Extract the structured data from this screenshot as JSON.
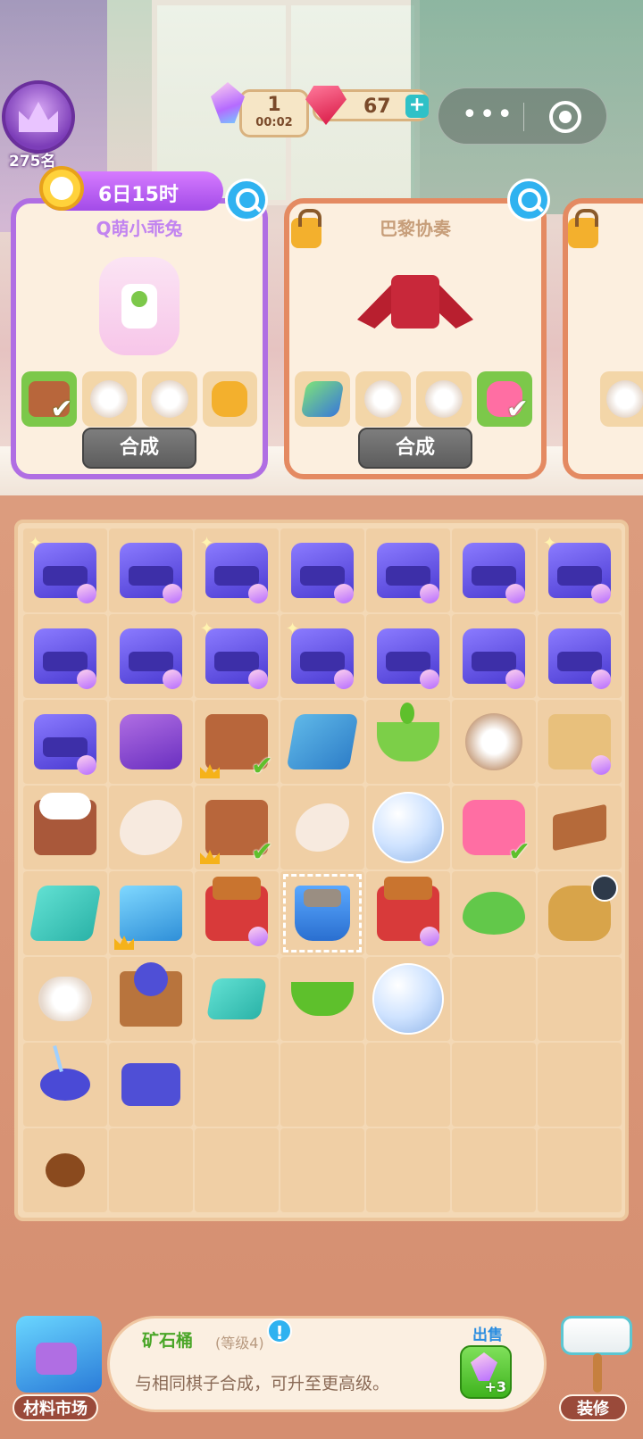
{
  "hud": {
    "rank": "275名",
    "energy": "1",
    "energy_timer": "00:02",
    "gems": "67",
    "plus": "+",
    "menu_dots": "•••"
  },
  "orders": [
    {
      "name": "Q萌小乖兔",
      "timer": "6日15时",
      "combine": "合成",
      "locked": false
    },
    {
      "name": "巴黎协奏",
      "combine": "合成",
      "locked": true
    }
  ],
  "selected_item": {
    "name": "矿石桶",
    "level": "(等级4)",
    "description": "与相同棋子合成，可升至更高级。",
    "sell_label": "出售",
    "sell_value": "+3"
  },
  "bottom": {
    "market_label": "材料市场",
    "decor_label": "装修"
  },
  "board": {
    "rows": 8,
    "cols": 7,
    "items": [
      [
        "sewing-kit",
        "sewing-kit",
        "sewing-kit",
        "sewing-kit",
        "sewing-kit",
        "sewing-kit",
        "sewing-kit"
      ],
      [
        "sewing-kit",
        "sewing-kit",
        "sewing-kit",
        "sewing-kit",
        "sewing-kit",
        "sewing-kit",
        "sewing-kit"
      ],
      [
        "sewing-kit",
        "sewing-machine",
        "fabric-bag",
        "cloth-stack",
        "plant-pot",
        "towel-basket",
        "seedling-box"
      ],
      [
        "cotton-box",
        "feather",
        "fabric-bag",
        "feather-pair",
        "ore-bubble",
        "mixer",
        "leather-piece"
      ],
      [
        "teal-cloth",
        "blue-toolbox",
        "red-bag",
        "ore-bucket",
        "red-bag",
        "silkworm-leaf",
        "seed-sack"
      ],
      [
        "cotton-roll",
        "thread-loom",
        "teal-fabric",
        "soil-bowl",
        "cocoon-bubble",
        "",
        ""
      ],
      [
        "pin-cushion",
        "thread-spool",
        "",
        "",
        "",
        "",
        ""
      ],
      [
        "seed",
        "",
        "",
        "",
        "",
        "",
        ""
      ]
    ]
  }
}
